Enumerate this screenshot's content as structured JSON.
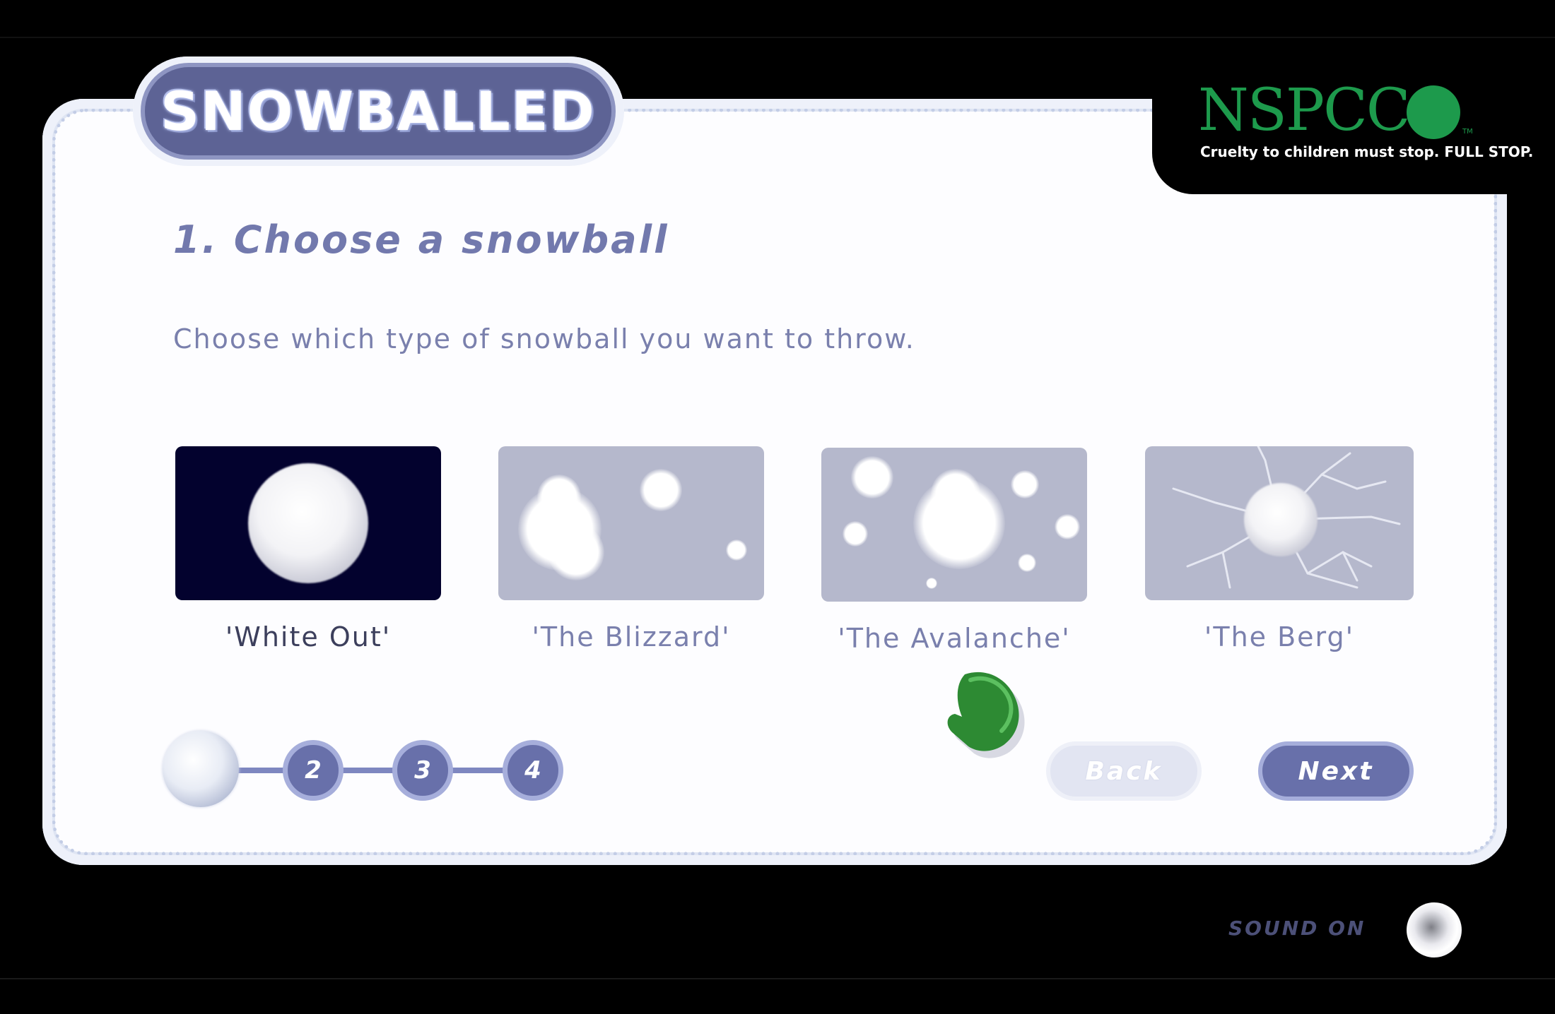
{
  "app": {
    "logo_text": "SNOWBALLED"
  },
  "sponsor": {
    "name": "NSPCC",
    "tm": "TM",
    "tagline": "Cruelty to children must stop. FULL STOP."
  },
  "step": {
    "heading": "1. Choose a snowball",
    "instructions": "Choose which type of snowball you want to throw."
  },
  "options": [
    {
      "label": "'White Out'",
      "selected": true
    },
    {
      "label": "'The Blizzard'",
      "selected": false
    },
    {
      "label": "'The Avalanche'",
      "selected": false
    },
    {
      "label": "'The Berg'",
      "selected": false
    }
  ],
  "progress": {
    "current_step": 1,
    "steps": [
      "2",
      "3",
      "4"
    ]
  },
  "nav": {
    "back_label": "Back",
    "next_label": "Next"
  },
  "sound": {
    "label": "SOUND ON"
  },
  "colors": {
    "accent": "#6870aa",
    "heading": "#7279ad",
    "nspcc_green": "#1d9a4c",
    "background": "#000000",
    "panel": "#fdfdff"
  },
  "icons": {
    "mitten": "green-mitten-cursor-icon",
    "sound": "sound-toggle-knob-icon"
  }
}
